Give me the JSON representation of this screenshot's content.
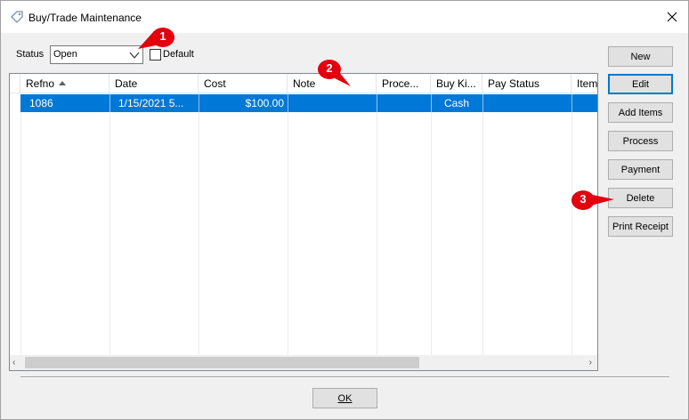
{
  "window": {
    "title": "Buy/Trade Maintenance"
  },
  "filters": {
    "status_label": "Status",
    "status_value": "Open",
    "default_label": "Default",
    "default_checked": false
  },
  "grid": {
    "columns": [
      "Refno",
      "Date",
      "Cost",
      "Note",
      "Proce...",
      "Buy Ki...",
      "Pay Status",
      "Item"
    ],
    "sorted_column": "Refno",
    "rows": [
      {
        "refno": "1086",
        "date": "1/15/2021 5...",
        "cost": "$100.00",
        "note": "",
        "process": "",
        "buy_kind": "Cash",
        "pay_status": "",
        "item": ""
      }
    ]
  },
  "buttons": {
    "new": "New",
    "edit": "Edit",
    "add_items": "Add Items",
    "process": "Process",
    "payment": "Payment",
    "delete": "Delete",
    "print_receipt": "Print Receipt",
    "ok": "OK"
  },
  "callouts": [
    "1",
    "2",
    "3"
  ],
  "colors": {
    "selection": "#0078d7",
    "callout": "#e3000f",
    "focus": "#0078d7"
  }
}
